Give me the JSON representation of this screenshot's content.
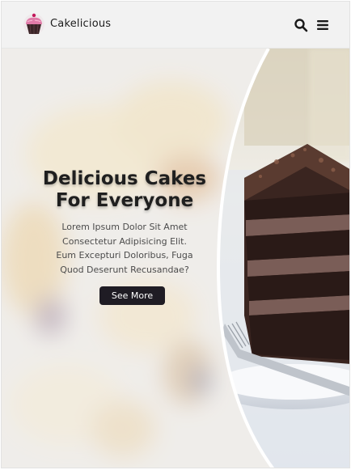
{
  "header": {
    "brand": "Cakelicious",
    "logo_icon": "cupcake-logo-icon",
    "search_icon": "search-icon",
    "menu_icon": "menu-icon"
  },
  "hero": {
    "title_line1": "Delicious Cakes",
    "title_line2": "For Everyone",
    "description": "Lorem Ipsum Dolor Sit Amet Consectetur Adipisicing Elit. Eum Excepturi Doloribus, Fuga Quod Deserunt Recusandae?",
    "button_label": "See More",
    "image_subject": "chocolate-layer-cake-slice"
  },
  "colors": {
    "header_bg": "#f2f2f2",
    "button_bg": "#1f1c24",
    "title_text": "#1f1f1f",
    "body_text": "#4c4c4c",
    "cake_chocolate": "#3a2520",
    "cake_frosting": "#7a5d57",
    "logo_pink": "#e07aa7"
  }
}
